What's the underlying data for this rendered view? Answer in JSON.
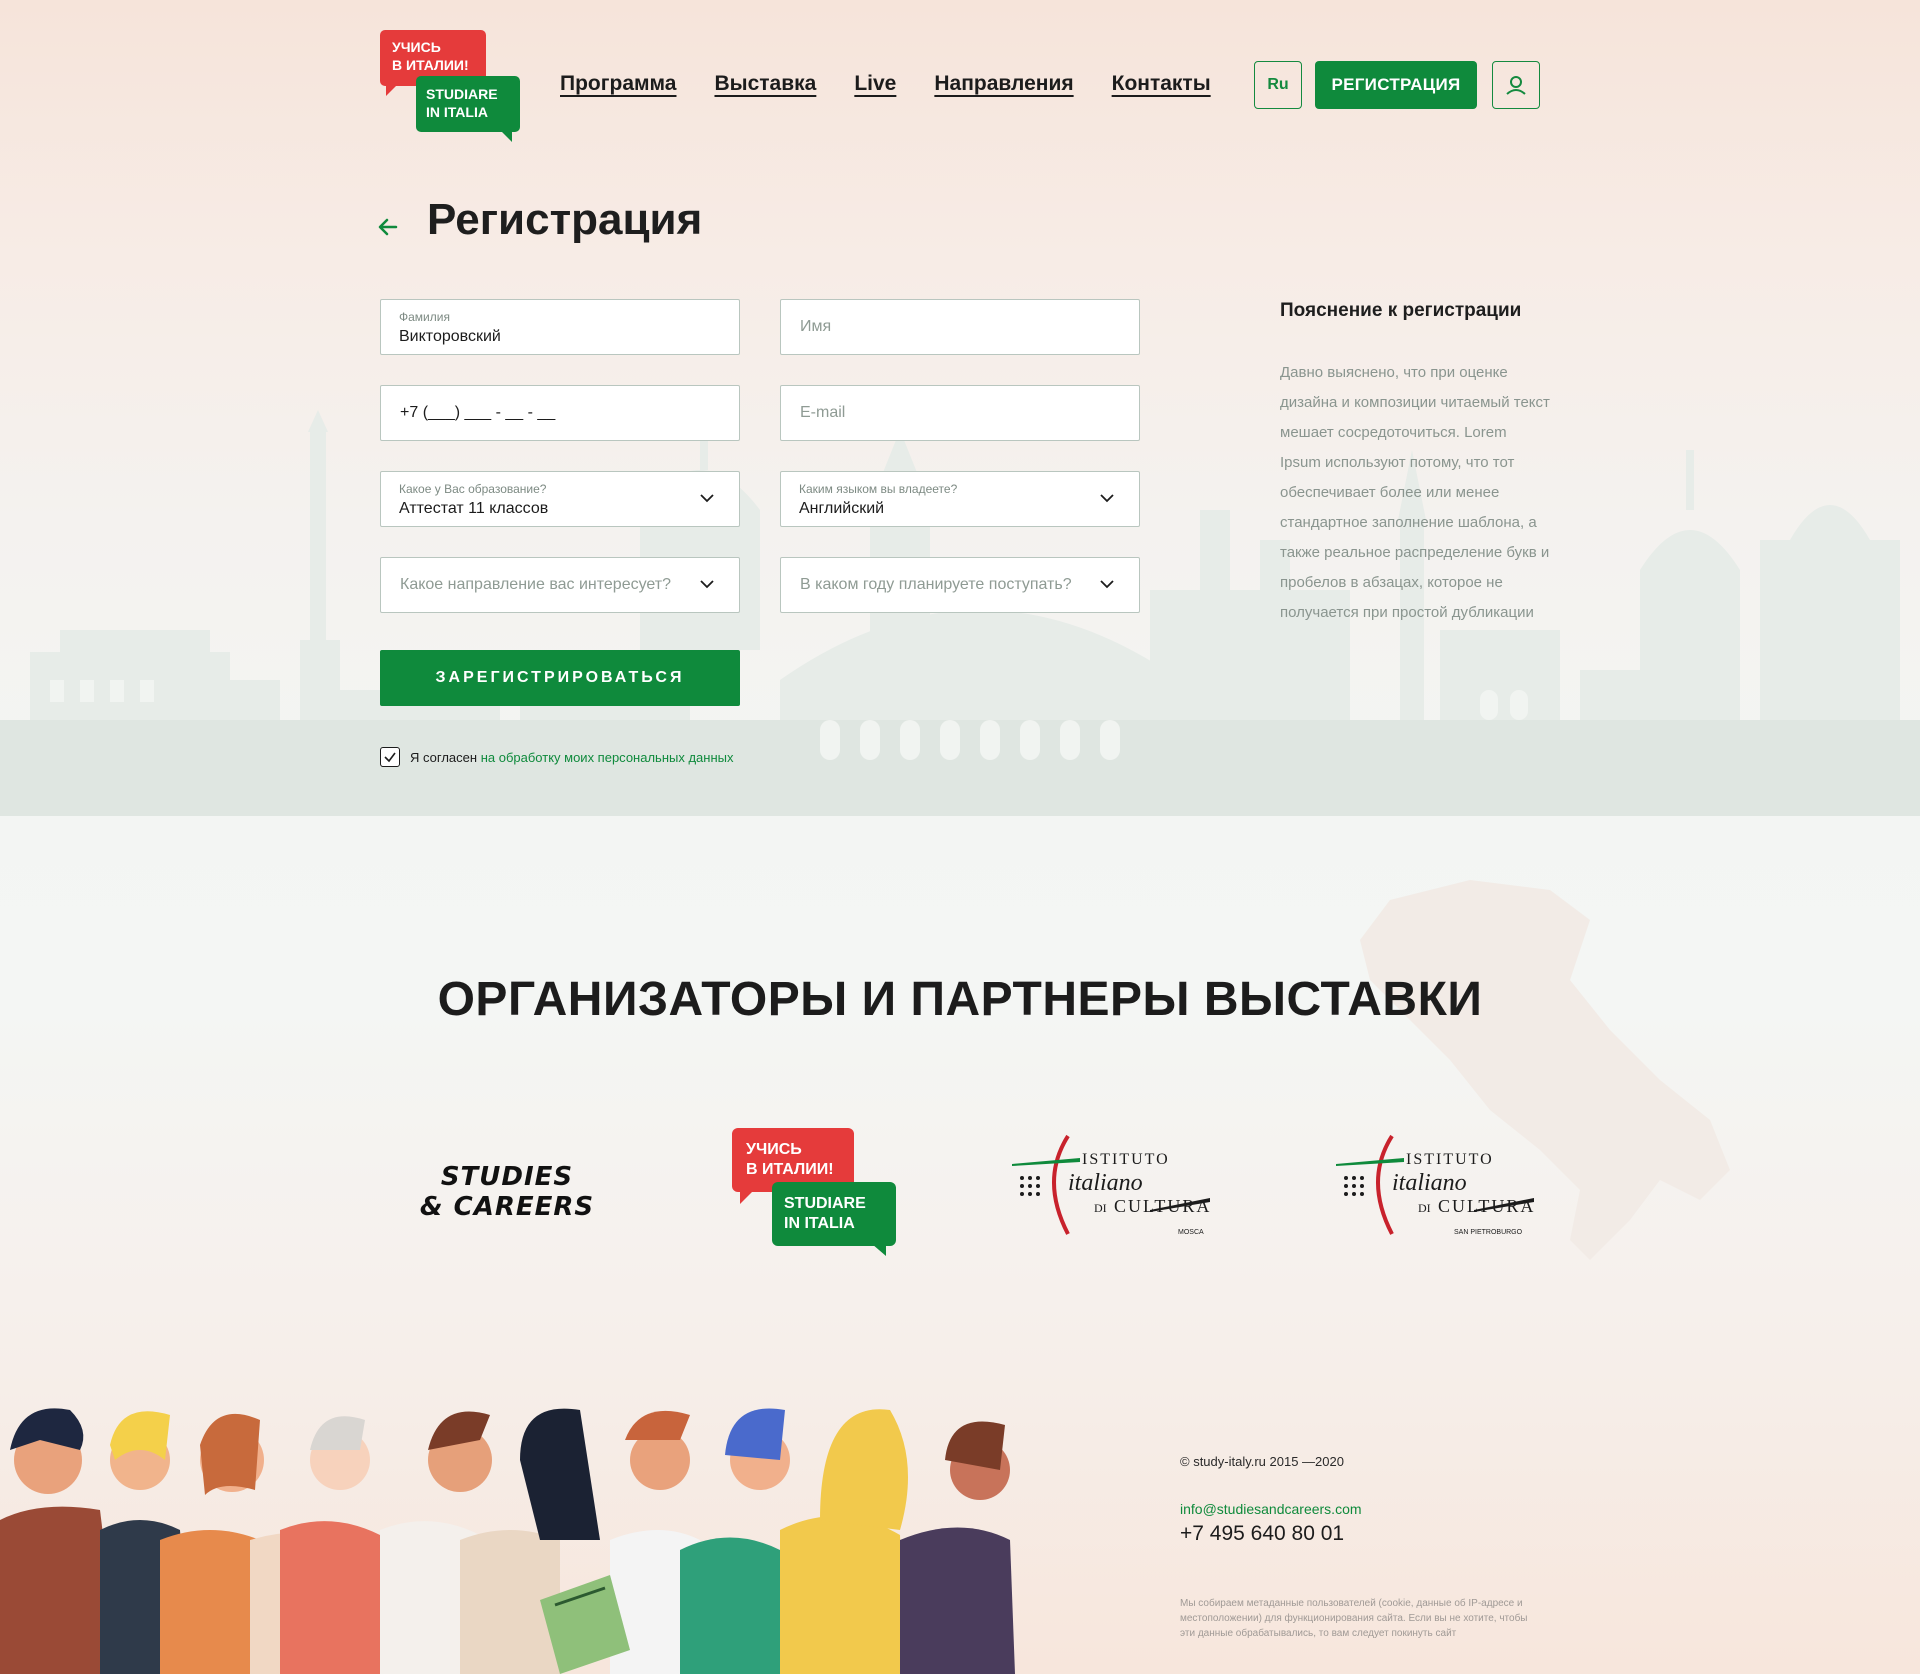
{
  "header": {
    "logo": {
      "line1": "УЧИСЬ",
      "line2": "В ИТАЛИИ!",
      "line3": "STUDIARE",
      "line4": "IN ITALIA"
    },
    "nav": [
      "Программа",
      "Выставка",
      "Live",
      "Направления",
      "Контакты"
    ],
    "lang": "Ru",
    "register": "РЕГИСТРАЦИЯ",
    "user_icon": "user-icon"
  },
  "page": {
    "title": "Регистрация",
    "back_icon": "arrow-left-icon"
  },
  "form": {
    "last_name": {
      "label": "Фамилия",
      "value": "Викторовский"
    },
    "first_name": {
      "placeholder": "Имя"
    },
    "phone": {
      "value": "+7 (___) ___ - __ - __"
    },
    "email": {
      "placeholder": "E-mail"
    },
    "education": {
      "label": "Какое у Вас образование?",
      "value": "Аттестат 11 классов"
    },
    "language": {
      "label": "Каким языком вы владеете?",
      "value": "Английский"
    },
    "direction": {
      "placeholder": "Какое направление вас интересует?"
    },
    "year": {
      "placeholder": "В каком году планируете поступать?"
    },
    "submit": "ЗАРЕГИСТРИРОВАТЬСЯ",
    "agree_text": "Я согласен",
    "agree_link": "на обработку моих персональных данных",
    "agree_checked": true
  },
  "explanation": {
    "title": "Пояснение к регистрации",
    "text": "Давно выяснено, что при оценке дизайна и композиции читаемый текст мешает сосредоточиться. Lorem Ipsum используют потому, что тот обеспечивает более или менее стандартное заполнение шаблона, а также реальное распределение букв и пробелов в абзацах, которое не получается при простой дубликации"
  },
  "partners": {
    "title": "ОРГАНИЗАТОРЫ И ПАРТНЕРЫ ВЫСТАВКИ",
    "studies_careers": {
      "line1": "STUDIES",
      "line2": "& CAREERS"
    },
    "studiare": {
      "line1": "УЧИСЬ",
      "line2": "В ИТАЛИИ!",
      "line3": "STUDIARE",
      "line4": "IN ITALIA"
    },
    "istituto1": {
      "line1": "ISTITUTO",
      "line2": "italiano",
      "line3": "DI",
      "line4": "CULTURA",
      "city": "MOSCA"
    },
    "istituto2": {
      "line1": "ISTITUTO",
      "line2": "italiano",
      "line3": "DI",
      "line4": "CULTURA",
      "city": "SAN PIETROBURGO"
    }
  },
  "footer": {
    "copyright": "© study-italy.ru 2015 —2020",
    "email": "info@studiesandcareers.com",
    "phone": "+7 495 640 80 01",
    "cookie": "Мы собираем метаданные пользователей (cookie, данные об IP-адресе и местоположении) для функционирования сайта. Если вы не хотите, чтобы эти данные обрабатывались, то вам следует покинуть сайт"
  },
  "colors": {
    "green": "#0f8a3c",
    "red": "#e53b3b",
    "text": "#1c1c1c"
  }
}
